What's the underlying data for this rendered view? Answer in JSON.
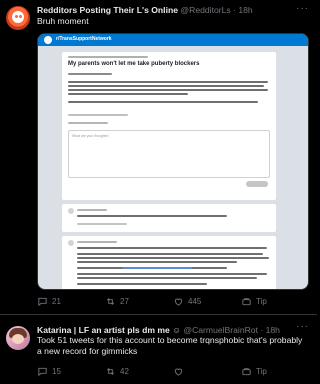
{
  "tweets": [
    {
      "author_name": "Redditors Posting Their L's Online",
      "author_handle": "@RedditorLs",
      "time": "18h",
      "text": "Bruh moment",
      "embed": {
        "subreddit": "r/TransSupportNetwork",
        "post_title": "My parents won't let me take puberty blockers",
        "comment_placeholder": "What are your thoughts?"
      },
      "stats": {
        "replies": "21",
        "retweets": "27",
        "likes": "445",
        "tip": "Tip"
      }
    },
    {
      "author_name": "Katarina | LF an artist pls dm me",
      "author_handle": "@CarmuelBrainRot",
      "time": "18h",
      "text": "Took 51 tweets for this account to become trqnsphobic that's probably a new record for gimmicks",
      "stats": {
        "replies": "15",
        "retweets": "42",
        "likes": "",
        "tip": "Tip"
      }
    }
  ]
}
